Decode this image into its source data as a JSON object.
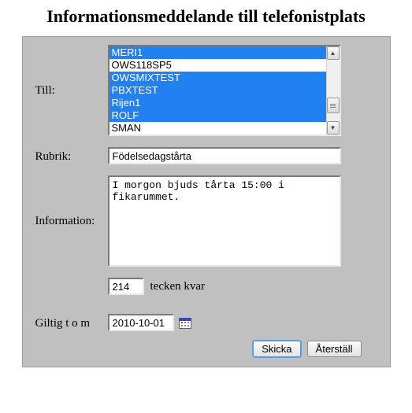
{
  "title": "Informationsmeddelande till telefonistplats",
  "labels": {
    "to": "Till:",
    "subject": "Rubrik:",
    "info": "Information:",
    "chars_left": "tecken kvar",
    "valid_until": "Giltig t o m"
  },
  "to_list": {
    "items": [
      {
        "text": "MERI1",
        "selected": true
      },
      {
        "text": "OWS118SP5",
        "selected": false
      },
      {
        "text": "OWSMIXTEST",
        "selected": true
      },
      {
        "text": "PBXTEST",
        "selected": true
      },
      {
        "text": "Rijen1",
        "selected": true
      },
      {
        "text": "ROLF",
        "selected": true
      },
      {
        "text": "SMAN",
        "selected": false
      }
    ]
  },
  "subject": {
    "value": "Födelsedagstårta"
  },
  "info": {
    "value": "I morgon bjuds tårta 15:00 i fikarummet."
  },
  "counter": {
    "value": "214"
  },
  "valid_until": {
    "value": "2010-10-01"
  },
  "buttons": {
    "send": "Skicka",
    "reset": "Återställ"
  }
}
